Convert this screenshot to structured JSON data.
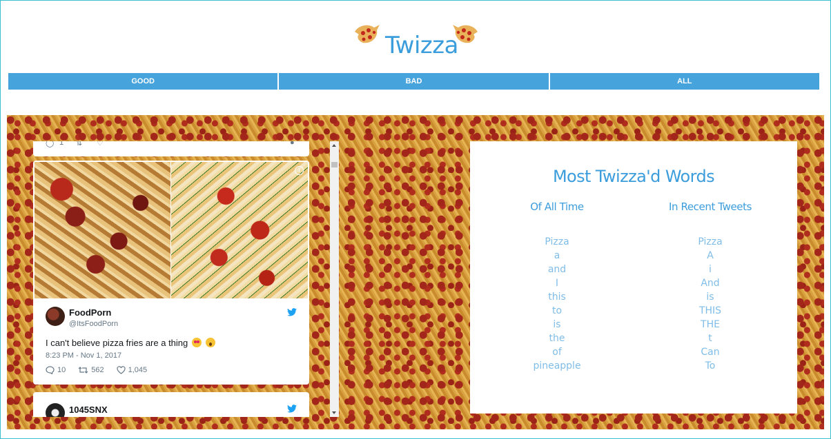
{
  "header": {
    "title": "Twizza",
    "logo_icon": "pizza-bird-icon"
  },
  "nav": {
    "items": [
      {
        "label": "GOOD"
      },
      {
        "label": "BAD"
      },
      {
        "label": "ALL"
      }
    ],
    "color": "#46a3dc"
  },
  "tweets": {
    "prev_tweet_counts": {
      "replies": "1"
    },
    "main": {
      "author": "FoodPorn",
      "handle": "@ItsFoodPorn",
      "text": "I can't believe pizza fries are a thing",
      "emojis": [
        "heart-eyes-emoji",
        "astonished-emoji"
      ],
      "timestamp": "8:23 PM - Nov 1, 2017",
      "replies": "10",
      "retweets": "562",
      "likes": "1,045"
    },
    "next": {
      "author": "1045SNX"
    }
  },
  "words": {
    "title": "Most Twizza'd Words",
    "all_time": {
      "heading": "Of All Time",
      "items": [
        "Pizza",
        "a",
        "and",
        "I",
        "this",
        "to",
        "is",
        "the",
        "of",
        "pineapple"
      ]
    },
    "recent": {
      "heading": "In Recent Tweets",
      "items": [
        "Pizza",
        "A",
        "i",
        "And",
        "is",
        "THIS",
        "THE",
        "t",
        "Can",
        "To"
      ]
    }
  },
  "colors": {
    "accent": "#3c9ddc",
    "word_list": "#7fbde8",
    "twitter_blue": "#1da1f2"
  }
}
